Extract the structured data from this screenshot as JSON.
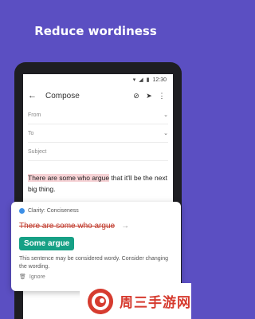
{
  "headline": "Reduce wordiness",
  "statusbar": {
    "time": "12:30"
  },
  "appbar": {
    "title": "Compose"
  },
  "fields": {
    "from_label": "From",
    "to_label": "To",
    "subject_label": "Subject"
  },
  "email": {
    "highlighted": "There are some who argue",
    "rest": " that it'll be the next big thing."
  },
  "suggestion_card": {
    "category": "Clarity: Conciseness",
    "original": "There are some who argue",
    "replacement": "Some argue",
    "explanation": "This sentence may be considered wordy. Consider changing the wording.",
    "ignore_label": "Ignore"
  },
  "watermark": {
    "text": "周三手游网"
  },
  "colors": {
    "background": "#5b4fc2",
    "accent_green": "#16a085",
    "strike_red": "#c0392b",
    "highlight": "#f7d3d6"
  }
}
